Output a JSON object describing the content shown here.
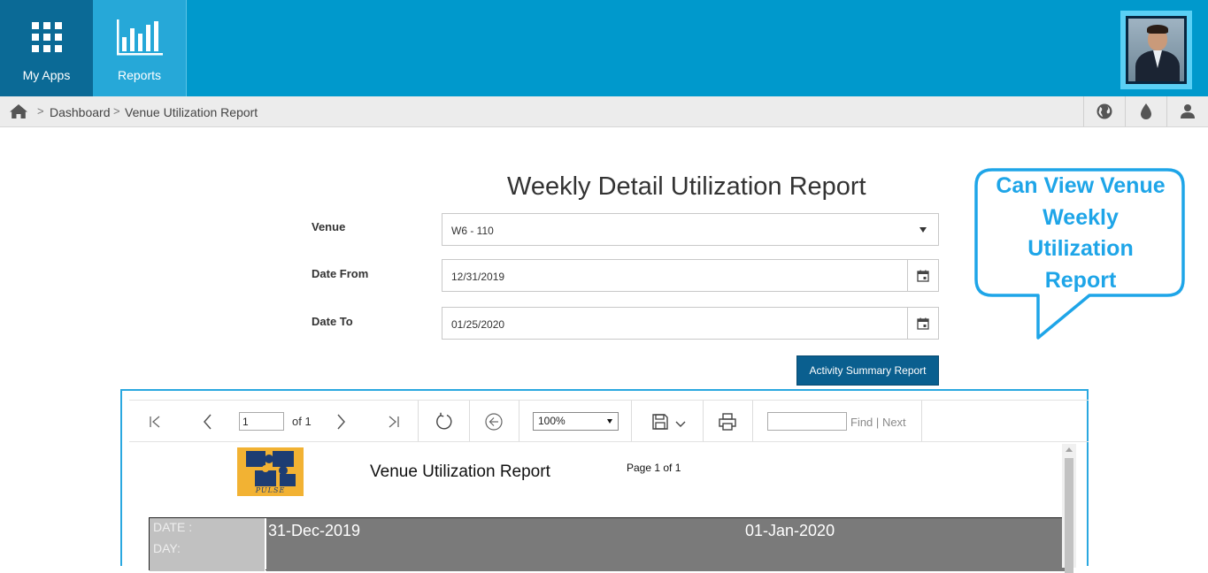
{
  "nav": {
    "myapps_label": "My Apps",
    "reports_label": "Reports"
  },
  "breadcrumb": {
    "sep": ">",
    "dashboard": "Dashboard",
    "current": "Venue Utilization Report"
  },
  "page": {
    "title": "Weekly Detail Utilization Report"
  },
  "form": {
    "venue_label": "Venue",
    "venue_value": "W6 - 110",
    "date_from_label": "Date From",
    "date_from_value": "12/31/2019",
    "date_to_label": "Date To",
    "date_to_value": "01/25/2020",
    "activity_button": "Activity Summary Report"
  },
  "callout": {
    "line1": "Can View Venue",
    "line2": "Weekly",
    "line3": "Utilization",
    "line4": "Report"
  },
  "viewer": {
    "page_value": "1",
    "page_of": "of 1",
    "zoom": "100%",
    "find_label": "Find",
    "find_sep": "|",
    "next_label": "Next"
  },
  "report": {
    "logo_text": "PULSE",
    "title": "Venue Utilization Report",
    "page_info": "Page 1 of 1",
    "date_label": "DATE :",
    "day_label": "DAY:",
    "date1": "31-Dec-2019",
    "date2": "01-Jan-2020"
  },
  "colors": {
    "topbar": "#0099cc",
    "myapps_tile": "#0b6a96",
    "reports_tile": "#26a8d8",
    "accent_button": "#0a5f8f",
    "callout": "#1ea5e8"
  }
}
